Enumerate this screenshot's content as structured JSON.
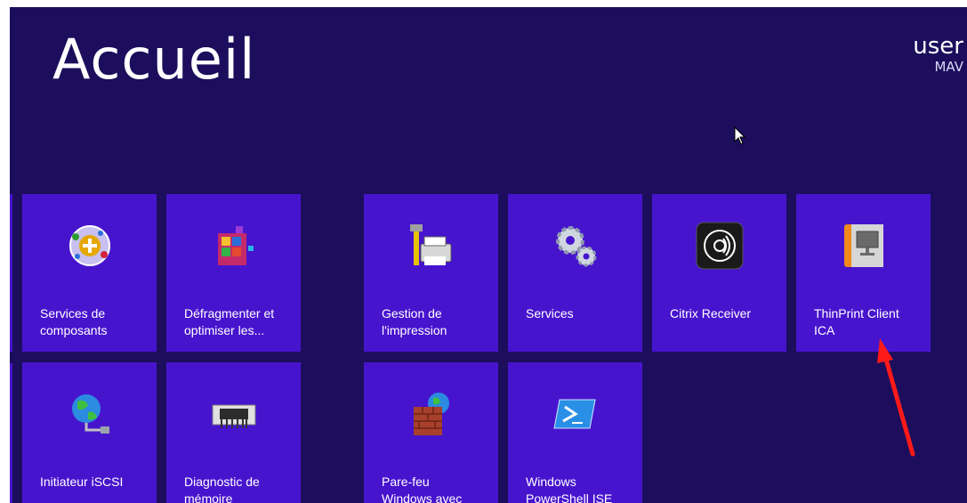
{
  "start": {
    "title": "Accueil"
  },
  "user": {
    "name": "user",
    "subtitle": "MAV"
  },
  "tiles": [
    {
      "label_line1": "Services de",
      "label_line2": "composants",
      "icon": "component-services-icon"
    },
    {
      "label_line1": "Défragmenter et",
      "label_line2": "optimiser les...",
      "icon": "defragment-icon"
    },
    {
      "label_line1": "Gestion de",
      "label_line2": "l'impression",
      "icon": "print-management-icon"
    },
    {
      "label_line1": "",
      "label_line2": "Services",
      "icon": "services-gears-icon"
    },
    {
      "label_line1": "",
      "label_line2": "Citrix Receiver",
      "icon": "citrix-receiver-icon"
    },
    {
      "label_line1": "ThinPrint Client",
      "label_line2": "ICA",
      "icon": "thinprint-client-icon"
    },
    {
      "label_line1": "Initiateur iSCSI",
      "label_line2": "",
      "icon": "iscsi-initiator-icon"
    },
    {
      "label_line1": "Diagnostic de",
      "label_line2": "mémoire",
      "icon": "memory-chip-icon"
    },
    {
      "label_line1": "Pare-feu",
      "label_line2": "Windows avec",
      "icon": "firewall-icon"
    },
    {
      "label_line1": "Windows",
      "label_line2": "PowerShell ISE",
      "icon": "powershell-icon"
    }
  ],
  "colors": {
    "background": "#1c0e5c",
    "tile": "#4714ce",
    "annotation_arrow": "#ff1a1a"
  }
}
